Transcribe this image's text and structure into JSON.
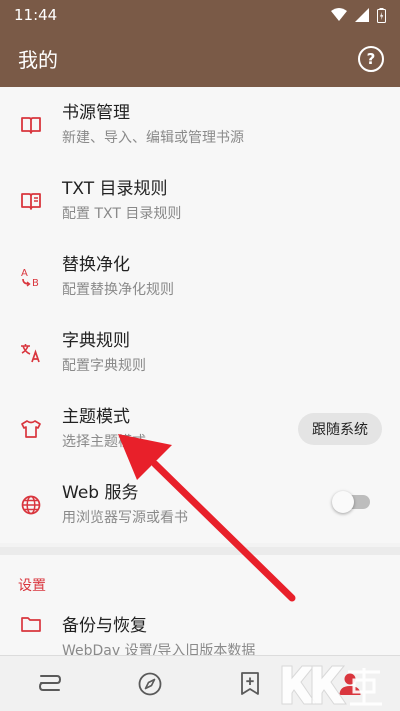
{
  "status_bar": {
    "time": "11:44"
  },
  "header": {
    "title": "我的",
    "help_icon": "help-circle-icon"
  },
  "items": [
    {
      "title": "书源管理",
      "subtitle": "新建、导入、编辑或管理书源",
      "icon": "book-icon"
    },
    {
      "title": "TXT 目录规则",
      "subtitle": "配置 TXT 目录规则",
      "icon": "book-toc-icon"
    },
    {
      "title": "替换净化",
      "subtitle": "配置替换净化规则",
      "icon": "replace-ab-icon"
    },
    {
      "title": "字典规则",
      "subtitle": "配置字典规则",
      "icon": "translate-icon"
    },
    {
      "title": "主题模式",
      "subtitle": "选择主题模式",
      "icon": "shirt-icon",
      "value": "跟随系统"
    },
    {
      "title": "Web 服务",
      "subtitle": "用浏览器写源或看书",
      "icon": "globe-icon",
      "toggle_on": false
    }
  ],
  "settings": {
    "section_title": "设置",
    "backup": {
      "title": "备份与恢复",
      "subtitle": "WebDav 设置/导入旧版本数据",
      "icon": "folder-icon"
    }
  },
  "bottom_nav": [
    {
      "name": "bookshelf",
      "icon": "bookshelf-icon",
      "active": false
    },
    {
      "name": "discover",
      "icon": "compass-icon",
      "active": false
    },
    {
      "name": "rss",
      "icon": "bookmark-plus-icon",
      "active": false
    },
    {
      "name": "my",
      "icon": "person-icon",
      "active": true
    }
  ],
  "watermark": {
    "text": "KK下载",
    "url": "www.kkx.net"
  },
  "colors": {
    "primary": "#7a5a47",
    "accent": "#d9363e",
    "annotation_arrow": "#e8202a"
  }
}
